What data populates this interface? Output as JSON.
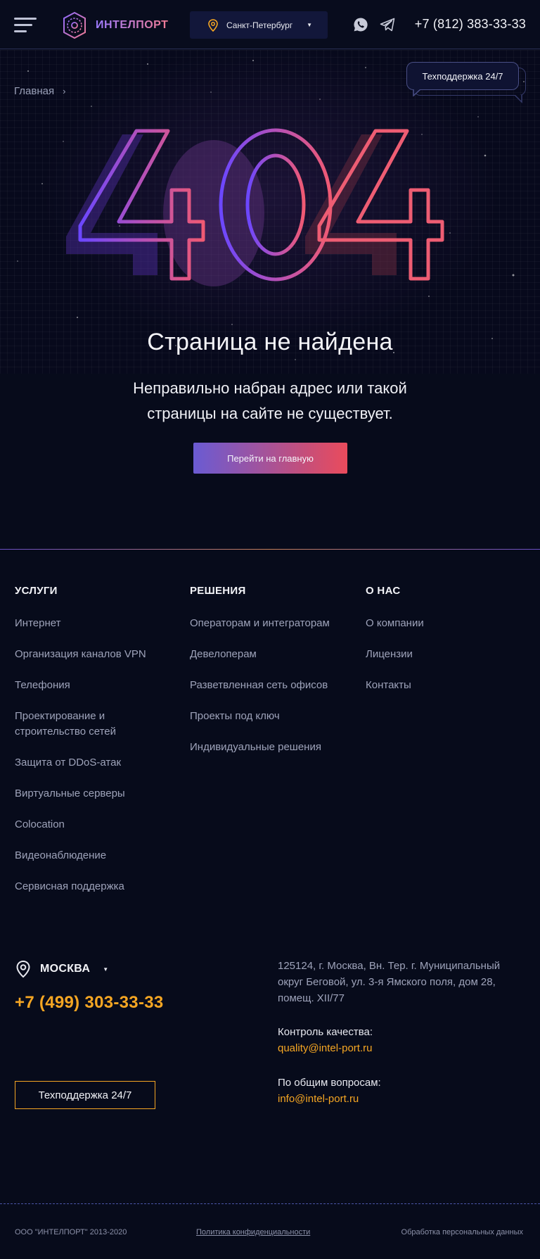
{
  "header": {
    "logo_text": "ИНТЕЛПОРТ",
    "city": "Санкт-Петербург",
    "phone": "+7 (812) 383-33-33"
  },
  "hero": {
    "breadcrumb_home": "Главная",
    "support_label": "Техподдержка 24/7",
    "error_code": "404",
    "title": "Страница не найдена",
    "text_line1": "Неправильно набран адрес или такой",
    "text_line2": "страницы на сайте не существует.",
    "home_button": "Перейти на главную"
  },
  "footer": {
    "services": {
      "heading": "УСЛУГИ",
      "items": [
        "Интернет",
        "Организация каналов VPN",
        "Телефония",
        "Проектирование и строительство сетей",
        "Защита от DDoS-атак",
        "Виртуальные серверы",
        "Colocation",
        "Видеонаблюдение",
        "Сервисная поддержка"
      ]
    },
    "solutions": {
      "heading": "РЕШЕНИЯ",
      "items": [
        "Операторам и интеграторам",
        "Девелоперам",
        "Разветвленная сеть офисов",
        "Проекты под ключ",
        "Индивидуальные решения"
      ]
    },
    "about": {
      "heading": "О НАС",
      "items": [
        "О компании",
        "Лицензии",
        "Контакты"
      ]
    },
    "city": "МОСКВА",
    "phone": "+7 (499) 303-33-33",
    "support_button": "Техподдержка 24/7",
    "address": "125124, г. Москва, Вн. Тер. г. Муниципальный округ Беговой,  ул. 3-я Ямского поля, дом 28, помещ. XII/77",
    "quality_label": "Контроль качества:",
    "quality_email": "quality@intel-port.ru",
    "general_label": "По общим вопросам:",
    "general_email": "info@intel-port.ru",
    "copyright": "ООО \"ИНТЕЛПОРТ\" 2013-2020",
    "privacy": "Политика конфиденциальности",
    "personal_data": "Обработка персональных данных"
  },
  "colors": {
    "background": "#070b1b",
    "accent_orange": "#f5a623",
    "gradient_start": "#6a5bd3",
    "gradient_end": "#ea4b5c"
  },
  "icons": [
    "burger-menu-icon",
    "logo-icon",
    "location-pin-icon",
    "whatsapp-icon",
    "telegram-icon",
    "chevron-right-icon",
    "caret-down-icon"
  ]
}
